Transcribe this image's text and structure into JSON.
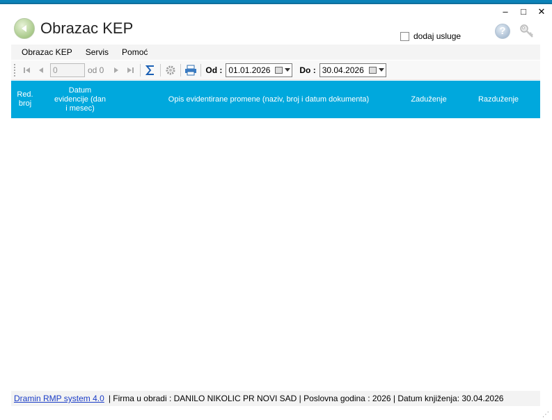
{
  "window": {
    "minimize": "–",
    "maximize": "□",
    "close": "✕"
  },
  "header": {
    "title": "Obrazac KEP",
    "add_services_label": "dodaj usluge"
  },
  "menu": {
    "items": [
      "Obrazac KEP",
      "Servis",
      "Pomoć"
    ]
  },
  "toolbar": {
    "position_value": "0",
    "of_label": "od 0",
    "from_label": "Od :",
    "from_date": "01.01.2026",
    "to_label": "Do :",
    "to_date": "30.04.2026"
  },
  "table": {
    "columns": [
      "Red. broj",
      "Datum evidencije (dan i mesec)",
      "Opis evidentirane promene (naziv, broj i datum dokumenta)",
      "Zaduženje",
      "Razduženje"
    ],
    "rows": []
  },
  "status": {
    "link": "Dramin RMP system 4.0",
    "text": "|  Firma u obradi : DANILO NIKOLIC PR NOVI SAD  |  Poslovna godina : 2026  |  Datum knjiženja: 30.04.2026"
  },
  "icons": {
    "back": "back-arrow-icon",
    "help": "help-icon",
    "key": "key-icon",
    "sum": "sigma-icon",
    "settings": "gear-icon",
    "print": "printer-icon",
    "calendar": "calendar-icon"
  },
  "colors": {
    "accent": "#00a8dd",
    "titlebar": "#0b82b8",
    "link": "#1a3cc7"
  }
}
